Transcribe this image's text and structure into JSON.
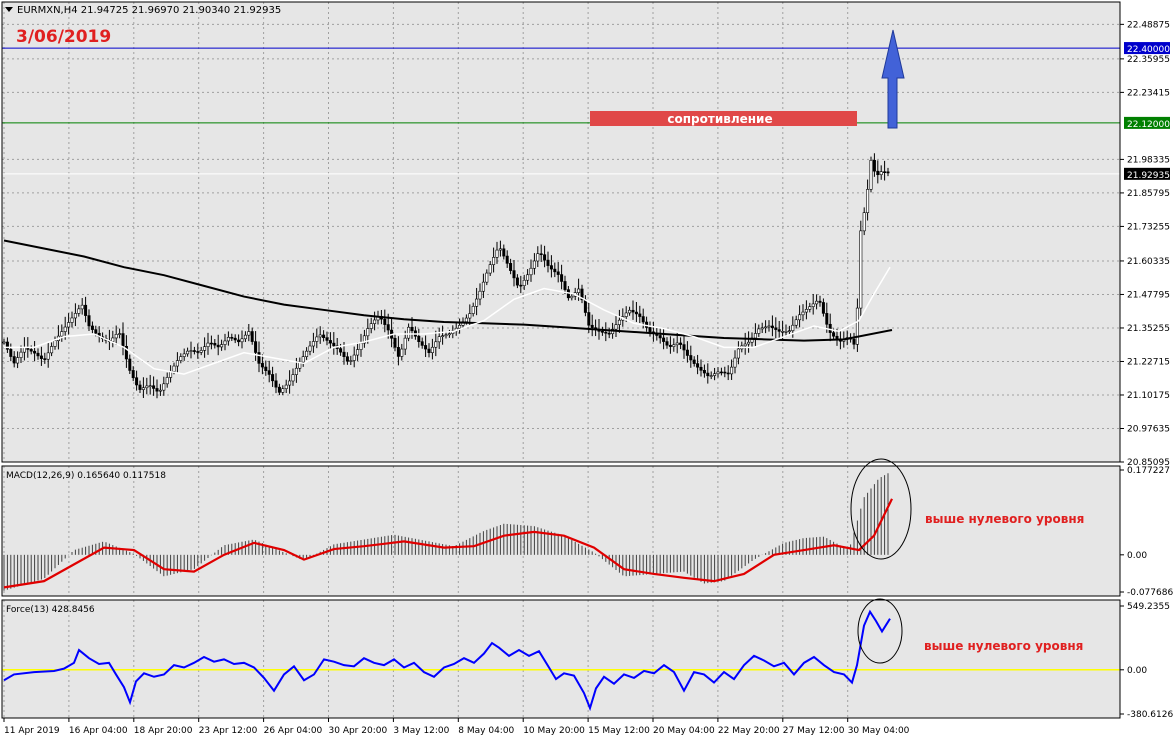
{
  "header": {
    "symbol_line": "EURMXN,H4  21.94725 21.96970 21.90340 21.92935",
    "date_stamp": "3/06/2019",
    "resistance_label": "сопротивление"
  },
  "colors": {
    "background": "#e6e6e6",
    "grid": "#a0a0a0",
    "candle": "#000000",
    "sma_slow": "#000000",
    "sma_fast": "#ffffff",
    "level_blue": "#0000cc",
    "level_green": "#008000",
    "macd_signal": "#e00000",
    "force_line": "#0000ff",
    "force_zero": "#ffff00",
    "arrow": "#4060d0",
    "annotation_red": "#e02020"
  },
  "chart_data": [
    {
      "type": "candlestick",
      "title": "EURMXN,H4",
      "ohlc_last": {
        "open": 21.94725,
        "high": 21.9697,
        "low": 21.9034,
        "close": 21.92935
      },
      "y_ticks": [
        "22.48875",
        "22.35955",
        "22.23415",
        "21.98335",
        "21.85795",
        "21.73255",
        "21.60335",
        "21.47795",
        "21.35255",
        "21.22715",
        "21.10175",
        "20.97635",
        "20.85095"
      ],
      "ylim": [
        20.85095,
        22.52
      ],
      "levels": [
        {
          "value": 22.4,
          "label": "22.40000",
          "color": "#0000cc"
        },
        {
          "value": 22.12,
          "label": "22.12000",
          "color": "#008000"
        },
        {
          "value": 21.92935,
          "label": "21.92935",
          "color": "#ffffff"
        }
      ],
      "x_labels": [
        "11 Apr 2019",
        "16 Apr 04:00",
        "18 Apr 20:00",
        "23 Apr 12:00",
        "26 Apr 04:00",
        "30 Apr 20:00",
        "3 May 12:00",
        "8 May 04:00",
        "10 May 20:00",
        "15 May 12:00",
        "20 May 04:00",
        "22 May 20:00",
        "27 May 12:00",
        "30 May 04:00"
      ],
      "annotations": [
        "сопротивление"
      ],
      "close_path": [
        [
          0,
          21.3
        ],
        [
          10,
          21.22
        ],
        [
          20,
          21.28
        ],
        [
          30,
          21.26
        ],
        [
          40,
          21.23
        ],
        [
          50,
          21.3
        ],
        [
          60,
          21.35
        ],
        [
          70,
          21.4
        ],
        [
          78,
          21.44
        ],
        [
          85,
          21.36
        ],
        [
          95,
          21.32
        ],
        [
          105,
          21.3
        ],
        [
          115,
          21.34
        ],
        [
          125,
          21.2
        ],
        [
          135,
          21.12
        ],
        [
          145,
          21.14
        ],
        [
          155,
          21.11
        ],
        [
          165,
          21.18
        ],
        [
          175,
          21.24
        ],
        [
          185,
          21.27
        ],
        [
          195,
          21.26
        ],
        [
          205,
          21.3
        ],
        [
          215,
          21.28
        ],
        [
          225,
          21.32
        ],
        [
          235,
          21.3
        ],
        [
          245,
          21.34
        ],
        [
          255,
          21.22
        ],
        [
          265,
          21.18
        ],
        [
          275,
          21.11
        ],
        [
          285,
          21.15
        ],
        [
          295,
          21.22
        ],
        [
          305,
          21.28
        ],
        [
          315,
          21.33
        ],
        [
          325,
          21.3
        ],
        [
          335,
          21.27
        ],
        [
          345,
          21.22
        ],
        [
          355,
          21.28
        ],
        [
          365,
          21.36
        ],
        [
          375,
          21.4
        ],
        [
          385,
          21.34
        ],
        [
          395,
          21.24
        ],
        [
          405,
          21.36
        ],
        [
          415,
          21.3
        ],
        [
          425,
          21.26
        ],
        [
          435,
          21.32
        ],
        [
          445,
          21.33
        ],
        [
          455,
          21.36
        ],
        [
          465,
          21.4
        ],
        [
          475,
          21.48
        ],
        [
          485,
          21.58
        ],
        [
          495,
          21.66
        ],
        [
          505,
          21.58
        ],
        [
          515,
          21.5
        ],
        [
          525,
          21.56
        ],
        [
          535,
          21.64
        ],
        [
          545,
          21.58
        ],
        [
          555,
          21.55
        ],
        [
          565,
          21.46
        ],
        [
          575,
          21.5
        ],
        [
          585,
          21.36
        ],
        [
          595,
          21.34
        ],
        [
          605,
          21.33
        ],
        [
          615,
          21.38
        ],
        [
          625,
          21.42
        ],
        [
          635,
          21.4
        ],
        [
          645,
          21.34
        ],
        [
          655,
          21.32
        ],
        [
          665,
          21.28
        ],
        [
          675,
          21.3
        ],
        [
          685,
          21.24
        ],
        [
          695,
          21.2
        ],
        [
          705,
          21.17
        ],
        [
          715,
          21.19
        ],
        [
          725,
          21.18
        ],
        [
          735,
          21.28
        ],
        [
          745,
          21.3
        ],
        [
          755,
          21.35
        ],
        [
          765,
          21.36
        ],
        [
          775,
          21.34
        ],
        [
          785,
          21.34
        ],
        [
          795,
          21.4
        ],
        [
          805,
          21.43
        ],
        [
          815,
          21.46
        ],
        [
          825,
          21.34
        ],
        [
          835,
          21.3
        ],
        [
          845,
          21.32
        ],
        [
          852,
          21.28
        ],
        [
          856,
          21.7
        ],
        [
          862,
          21.82
        ],
        [
          867,
          21.98
        ],
        [
          872,
          21.92
        ],
        [
          878,
          21.94
        ],
        [
          886,
          21.93
        ]
      ],
      "sma_slow_path": [
        [
          0,
          21.68
        ],
        [
          40,
          21.65
        ],
        [
          80,
          21.62
        ],
        [
          120,
          21.58
        ],
        [
          160,
          21.55
        ],
        [
          200,
          21.51
        ],
        [
          240,
          21.47
        ],
        [
          280,
          21.44
        ],
        [
          320,
          21.42
        ],
        [
          360,
          21.4
        ],
        [
          400,
          21.385
        ],
        [
          440,
          21.375
        ],
        [
          480,
          21.37
        ],
        [
          520,
          21.365
        ],
        [
          560,
          21.355
        ],
        [
          600,
          21.345
        ],
        [
          640,
          21.335
        ],
        [
          680,
          21.325
        ],
        [
          720,
          21.315
        ],
        [
          760,
          21.31
        ],
        [
          800,
          21.305
        ],
        [
          840,
          21.31
        ],
        [
          888,
          21.345
        ]
      ],
      "sma_fast_path": [
        [
          0,
          21.28
        ],
        [
          30,
          21.28
        ],
        [
          60,
          21.32
        ],
        [
          90,
          21.33
        ],
        [
          120,
          21.28
        ],
        [
          150,
          21.2
        ],
        [
          180,
          21.18
        ],
        [
          210,
          21.22
        ],
        [
          240,
          21.26
        ],
        [
          270,
          21.24
        ],
        [
          300,
          21.22
        ],
        [
          330,
          21.28
        ],
        [
          360,
          21.3
        ],
        [
          390,
          21.33
        ],
        [
          420,
          21.33
        ],
        [
          450,
          21.34
        ],
        [
          480,
          21.38
        ],
        [
          510,
          21.46
        ],
        [
          540,
          21.5
        ],
        [
          570,
          21.48
        ],
        [
          600,
          21.42
        ],
        [
          630,
          21.37
        ],
        [
          660,
          21.35
        ],
        [
          690,
          21.32
        ],
        [
          720,
          21.28
        ],
        [
          750,
          21.28
        ],
        [
          780,
          21.32
        ],
        [
          810,
          21.36
        ],
        [
          835,
          21.34
        ],
        [
          855,
          21.38
        ],
        [
          870,
          21.48
        ],
        [
          886,
          21.58
        ]
      ]
    },
    {
      "type": "bar",
      "title": "MACD(12,26,9) 0.165640 0.117518",
      "y_ticks": [
        "0.177227",
        "0.00",
        "-0.077686"
      ],
      "ylim": [
        -0.077686,
        0.177227
      ],
      "histogram_path": [
        [
          0,
          -0.075
        ],
        [
          40,
          -0.05
        ],
        [
          70,
          0.01
        ],
        [
          100,
          0.028
        ],
        [
          130,
          0.002
        ],
        [
          160,
          -0.045
        ],
        [
          190,
          -0.03
        ],
        [
          220,
          0.02
        ],
        [
          250,
          0.032
        ],
        [
          280,
          0.005
        ],
        [
          300,
          -0.012
        ],
        [
          330,
          0.022
        ],
        [
          360,
          0.032
        ],
        [
          390,
          0.042
        ],
        [
          420,
          0.03
        ],
        [
          450,
          0.018
        ],
        [
          480,
          0.05
        ],
        [
          500,
          0.065
        ],
        [
          530,
          0.06
        ],
        [
          560,
          0.04
        ],
        [
          590,
          0.005
        ],
        [
          620,
          -0.045
        ],
        [
          650,
          -0.04
        ],
        [
          680,
          -0.035
        ],
        [
          700,
          -0.06
        ],
        [
          720,
          -0.055
        ],
        [
          750,
          -0.01
        ],
        [
          780,
          0.025
        ],
        [
          800,
          0.035
        ],
        [
          820,
          0.038
        ],
        [
          845,
          0.01
        ],
        [
          860,
          0.12
        ],
        [
          875,
          0.16
        ],
        [
          888,
          0.175
        ]
      ],
      "signal_path": [
        [
          0,
          -0.068
        ],
        [
          40,
          -0.055
        ],
        [
          70,
          -0.02
        ],
        [
          100,
          0.015
        ],
        [
          130,
          0.01
        ],
        [
          160,
          -0.03
        ],
        [
          190,
          -0.035
        ],
        [
          220,
          0.0
        ],
        [
          250,
          0.025
        ],
        [
          280,
          0.01
        ],
        [
          300,
          -0.01
        ],
        [
          330,
          0.012
        ],
        [
          360,
          0.018
        ],
        [
          400,
          0.028
        ],
        [
          440,
          0.015
        ],
        [
          470,
          0.018
        ],
        [
          500,
          0.04
        ],
        [
          530,
          0.048
        ],
        [
          560,
          0.04
        ],
        [
          590,
          0.015
        ],
        [
          620,
          -0.03
        ],
        [
          650,
          -0.04
        ],
        [
          680,
          -0.048
        ],
        [
          710,
          -0.055
        ],
        [
          740,
          -0.04
        ],
        [
          770,
          0.0
        ],
        [
          800,
          0.01
        ],
        [
          830,
          0.02
        ],
        [
          855,
          0.01
        ],
        [
          870,
          0.04
        ],
        [
          888,
          0.117
        ]
      ],
      "annotations": [
        "выше нулевого уровня"
      ]
    },
    {
      "type": "line",
      "title": "Force(13) 428.8456",
      "y_ticks": [
        "549.2355",
        "0.00",
        "-380.6126"
      ],
      "ylim": [
        -380.6126,
        549.2355
      ],
      "path": [
        [
          0,
          -90
        ],
        [
          10,
          -40
        ],
        [
          30,
          -20
        ],
        [
          50,
          -10
        ],
        [
          60,
          10
        ],
        [
          70,
          60
        ],
        [
          75,
          170
        ],
        [
          85,
          100
        ],
        [
          95,
          50
        ],
        [
          105,
          60
        ],
        [
          112,
          -40
        ],
        [
          120,
          -150
        ],
        [
          126,
          -280
        ],
        [
          132,
          -100
        ],
        [
          140,
          -30
        ],
        [
          150,
          -60
        ],
        [
          160,
          -40
        ],
        [
          170,
          40
        ],
        [
          180,
          20
        ],
        [
          190,
          60
        ],
        [
          200,
          110
        ],
        [
          210,
          70
        ],
        [
          220,
          90
        ],
        [
          230,
          50
        ],
        [
          240,
          60
        ],
        [
          250,
          20
        ],
        [
          260,
          -70
        ],
        [
          270,
          -180
        ],
        [
          280,
          -40
        ],
        [
          290,
          30
        ],
        [
          300,
          -90
        ],
        [
          310,
          -40
        ],
        [
          320,
          90
        ],
        [
          330,
          70
        ],
        [
          340,
          40
        ],
        [
          350,
          30
        ],
        [
          360,
          100
        ],
        [
          370,
          60
        ],
        [
          380,
          40
        ],
        [
          390,
          90
        ],
        [
          400,
          20
        ],
        [
          410,
          60
        ],
        [
          420,
          -20
        ],
        [
          430,
          -60
        ],
        [
          440,
          20
        ],
        [
          450,
          50
        ],
        [
          460,
          100
        ],
        [
          470,
          60
        ],
        [
          480,
          140
        ],
        [
          488,
          230
        ],
        [
          495,
          190
        ],
        [
          505,
          120
        ],
        [
          515,
          170
        ],
        [
          525,
          120
        ],
        [
          535,
          160
        ],
        [
          545,
          20
        ],
        [
          552,
          -80
        ],
        [
          560,
          -30
        ],
        [
          570,
          -50
        ],
        [
          580,
          -200
        ],
        [
          586,
          -330
        ],
        [
          592,
          -160
        ],
        [
          600,
          -60
        ],
        [
          610,
          -120
        ],
        [
          620,
          -40
        ],
        [
          630,
          -70
        ],
        [
          640,
          -10
        ],
        [
          650,
          -30
        ],
        [
          660,
          40
        ],
        [
          670,
          -20
        ],
        [
          680,
          -180
        ],
        [
          690,
          -20
        ],
        [
          700,
          -40
        ],
        [
          710,
          -110
        ],
        [
          720,
          -20
        ],
        [
          730,
          -80
        ],
        [
          740,
          40
        ],
        [
          750,
          120
        ],
        [
          760,
          80
        ],
        [
          770,
          30
        ],
        [
          780,
          60
        ],
        [
          790,
          -40
        ],
        [
          800,
          60
        ],
        [
          810,
          110
        ],
        [
          820,
          40
        ],
        [
          830,
          -20
        ],
        [
          840,
          -40
        ],
        [
          848,
          -110
        ],
        [
          853,
          40
        ],
        [
          860,
          380
        ],
        [
          866,
          500
        ],
        [
          872,
          420
        ],
        [
          878,
          330
        ],
        [
          886,
          440
        ]
      ],
      "zero_line": 0,
      "annotations": [
        "выше нулевого уровня"
      ]
    }
  ]
}
